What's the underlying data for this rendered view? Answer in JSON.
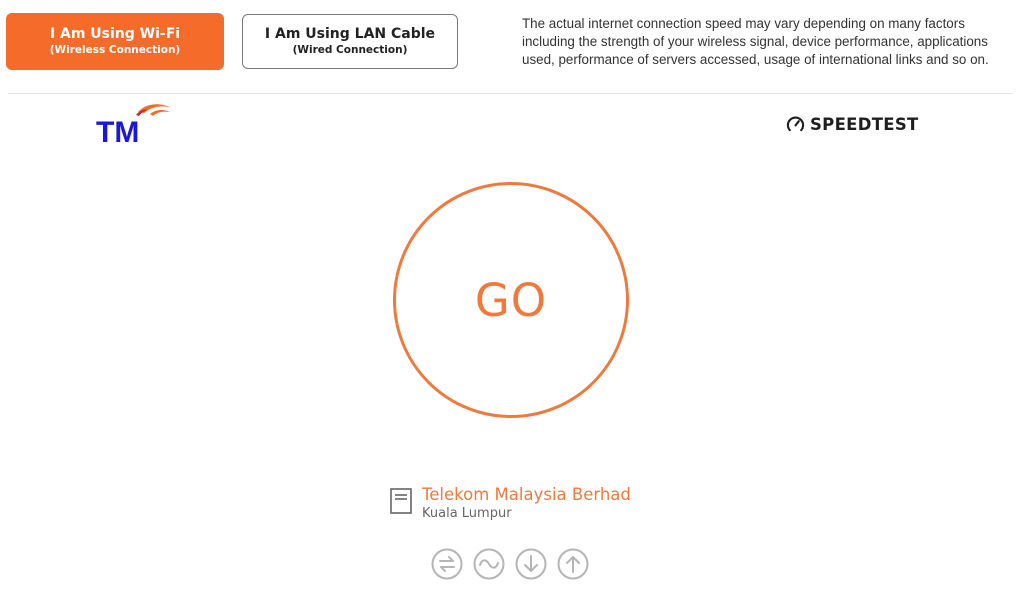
{
  "connection_buttons": {
    "wifi": {
      "label": "I Am Using Wi-Fi",
      "sublabel": "(Wireless Connection)",
      "selected": true
    },
    "lan": {
      "label": "I Am Using LAN Cable",
      "sublabel": "(Wired Connection)",
      "selected": false
    }
  },
  "notice": {
    "text": "The actual internet connection speed may vary depending on many factors including the strength of your wireless signal, device performance, applications used, performance of servers accessed, usage of international links and so on."
  },
  "logos": {
    "tm": {
      "text": "TM",
      "icon": "tm-logo"
    },
    "speedtest": {
      "text": "SPEEDTEST",
      "icon": "speedometer-icon"
    }
  },
  "go_button": {
    "label": "GO"
  },
  "server": {
    "name": "Telekom Malaysia Berhad",
    "location": "Kuala Lumpur",
    "icon": "server-icon"
  },
  "metric_icons": [
    "ping-icon",
    "jitter-icon",
    "download-icon",
    "upload-icon"
  ],
  "colors": {
    "accent": "#f46b2a",
    "go": "#ee7a3d",
    "tm_blue": "#1a1ad6",
    "icon_grey": "#b5b5b5"
  }
}
